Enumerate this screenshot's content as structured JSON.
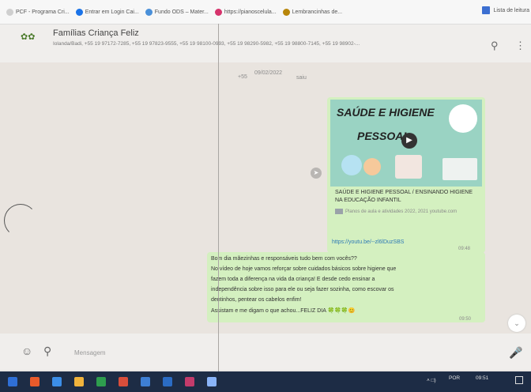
{
  "bookmarks": [
    {
      "label": "PCF - Programa Cri...",
      "color": "#cfcfcf"
    },
    {
      "label": "Entrar em Login Cai...",
      "color": "#1a73e8"
    },
    {
      "label": "Fundo ODS – Mater...",
      "color": "#4a90d9"
    },
    {
      "label": "https://pianoscelula...",
      "color": "#d6336c"
    },
    {
      "label": "Lembrancinhas de...",
      "color": "#b8860b"
    }
  ],
  "reading_list": "Lista de leitura",
  "chat": {
    "avatar_icon": "group-avatar-icon",
    "name": "Famílias Criança Feliz",
    "members": "Iolanda/Badi, +55 19 97172-7285, +55 19 97823-9555, +55 19 98100-0993, +55 19 98290-5982, +55 19 98800-7145, +55 19 98902-..."
  },
  "header_icons": [
    "search-icon",
    "more-icon"
  ],
  "system_messages": {
    "date_badge": "09/02/2022",
    "left_prefix": "+55",
    "left_suffix": "saiu"
  },
  "video_message": {
    "thumb_line1": "SAÚDE E HIGIENE",
    "thumb_line2": "PESSOAL",
    "title": "SAÚDE E HIGIENE PESSOAL / ENSINANDO HIGIENE NA EDUCAÇÃO INFANTIL",
    "description": "Planos de aula e atividades 2022, 2021 youtube.com",
    "link": "https://youtu.be/--zl6lDuzSBS",
    "time": "09:48"
  },
  "text_message": {
    "lines": [
      "Bom dia mãezinhas e responsáveis tudo bem com vocês??",
      "No vídeo de hoje vamos reforçar sobre cuidados básicos sobre higiene que",
      "fazem toda a diferença na vida da criança! E desde cedo ensinar a",
      "independência sobre isso para ele ou seja fazer sozinha, como escovar os",
      "dentinhos, pentear os cabelos enfim!",
      "Assistam e me digam o que achou...FELIZ DIA 🍀🍀🍀😊"
    ],
    "time": "09:50"
  },
  "compose": {
    "placeholder": "Mensagem"
  },
  "taskbar": {
    "language": "POR",
    "time": "09:51",
    "icon_colors": [
      "#2f6fd6",
      "#e85a2b",
      "#3c8ee8",
      "#f0b33c",
      "#2e9d4e",
      "#d94e3b",
      "#3e7fd4",
      "#2b6cc4",
      "#c33b6b",
      "#8ab4f8"
    ]
  }
}
